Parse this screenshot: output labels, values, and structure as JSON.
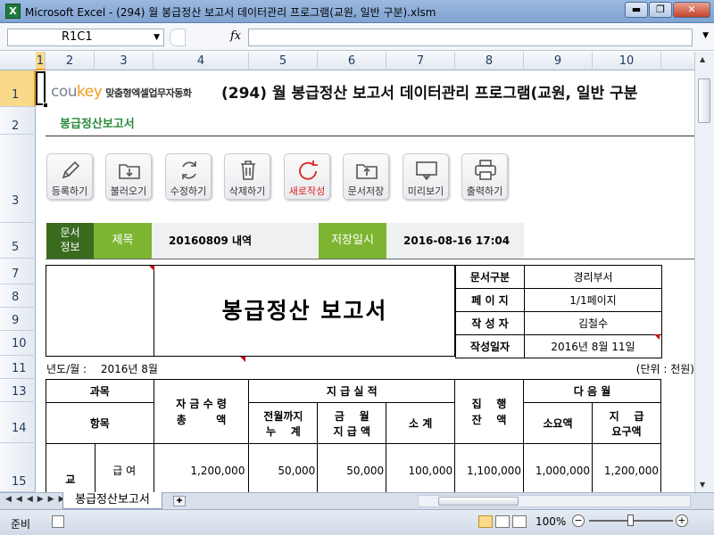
{
  "window": {
    "title": "Microsoft Excel - (294) 월 봉급정산 보고서 데이터관리 프로그램(교원, 일반 구분).xlsm",
    "min": "▬",
    "max": "❐",
    "close": "✕"
  },
  "formula_bar": {
    "name_box": "R1C1",
    "fx": "fx",
    "formula": ""
  },
  "columns": [
    "1",
    "2",
    "3",
    "4",
    "5",
    "6",
    "7",
    "8",
    "9",
    "10"
  ],
  "rows": [
    "1",
    "2",
    "3",
    "5",
    "7",
    "8",
    "9",
    "10",
    "11",
    "13",
    "14",
    "15"
  ],
  "logo": {
    "brand_a": "cou",
    "brand_b": "key",
    "tag": "맞춤형엑셀업무자동화"
  },
  "main_title": "(294) 월 봉급정산 보고서 데이터관리 프로그램(교원, 일반 구분",
  "subtitle": "봉급정산보고서",
  "toolbar": [
    {
      "label": "등록하기",
      "icon": "pencil-icon"
    },
    {
      "label": "불러오기",
      "icon": "open-folder-icon"
    },
    {
      "label": "수정하기",
      "icon": "refresh-icon"
    },
    {
      "label": "삭제하기",
      "icon": "trash-icon"
    },
    {
      "label": "새로작성",
      "icon": "new-circle-icon"
    },
    {
      "label": "문서저장",
      "icon": "save-folder-icon"
    },
    {
      "label": "미리보기",
      "icon": "preview-icon"
    },
    {
      "label": "출력하기",
      "icon": "printer-icon"
    }
  ],
  "docinfo": {
    "label": "문서\n정보",
    "title_label": "제목",
    "title_value": "20160809 내역",
    "save_label": "저장일시",
    "save_value": "2016-08-16 17:04"
  },
  "report": {
    "title": "봉급정산 보고서",
    "meta": [
      {
        "k": "문서구분",
        "v": "경리부서"
      },
      {
        "k": "페 이 지",
        "v": "1/1페이지"
      },
      {
        "k": "작 성 자",
        "v": "김철수"
      },
      {
        "k": "작성일자",
        "v": "2016년 8월 11일"
      }
    ],
    "year_month_label": "년도/월 :",
    "year_month_value": "2016년 8월",
    "unit": "(단위 : 천원)",
    "headers": {
      "subject": "과목",
      "item": "항목",
      "fund_total": "자 금 수 령\n총        액",
      "paid": "지    급    실    적",
      "prev": "전월까지\n누    계",
      "month": "금    월\n지 급 액",
      "subtotal": "소    계",
      "balance": "집    행\n잔    액",
      "next": "다 음 월",
      "need": "소요액",
      "req": "지    급\n요구액"
    },
    "row": {
      "group": "교",
      "item": "급  여",
      "fund": "1,200,000",
      "prev": "50,000",
      "month": "50,000",
      "subtotal": "100,000",
      "balance": "1,100,000",
      "need": "1,000,000",
      "req": "1,200,000"
    }
  },
  "sheet_tab": "봉급정산보고서",
  "status": {
    "ready": "준비",
    "zoom": "100%"
  }
}
